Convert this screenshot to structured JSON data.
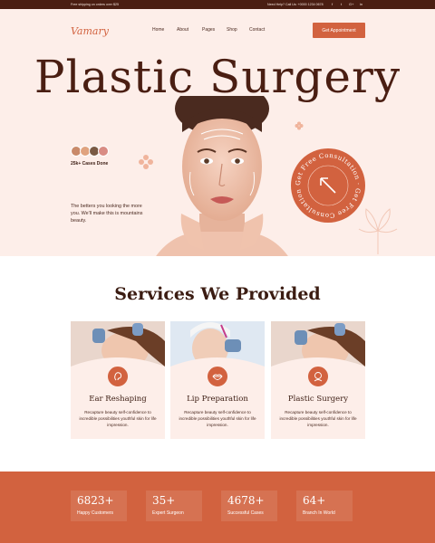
{
  "topbar": {
    "promo": "Free shipping on orders over $25",
    "phone": "Need Help? Call Us: +0000 1234 0678",
    "social": [
      "f",
      "t",
      "G+",
      "in"
    ]
  },
  "header": {
    "logo": "Vamary",
    "nav": [
      "Home",
      "About",
      "Pages",
      "Shop",
      "Contact"
    ],
    "cta": "Get Appointment"
  },
  "hero": {
    "title": "Plastic Surgery",
    "cases": "25k+ Cases Done",
    "description": "The betters you looking the more you. We'll make this is mountains beauty.",
    "consultation_text": "Get Free Consultation · Get Free Consultation ·"
  },
  "services": {
    "title": "Services We Provided",
    "items": [
      {
        "title": "Ear Reshaping",
        "text": "Recapture beauty self-confidence to incredible possibilities youthful skin for life impression.",
        "icon": "ear-icon"
      },
      {
        "title": "Lip Preparation",
        "text": "Recapture beauty self-confidence to incredible possibilities youthful skin for life impression.",
        "icon": "lips-icon"
      },
      {
        "title": "Plastic Surgery",
        "text": "Recapture beauty self-confidence to incredible possibilities youthful skin for life impression.",
        "icon": "face-icon"
      }
    ]
  },
  "stats": [
    {
      "value": "6823+",
      "label": "Happy Customers"
    },
    {
      "value": "35+",
      "label": "Expert Surgeon"
    },
    {
      "value": "4678+",
      "label": "Successful Cases"
    },
    {
      "value": "64+",
      "label": "Branch In World"
    }
  ],
  "colors": {
    "accent": "#d2623f",
    "dark": "#4a1e12",
    "blush": "#fdeee9"
  }
}
